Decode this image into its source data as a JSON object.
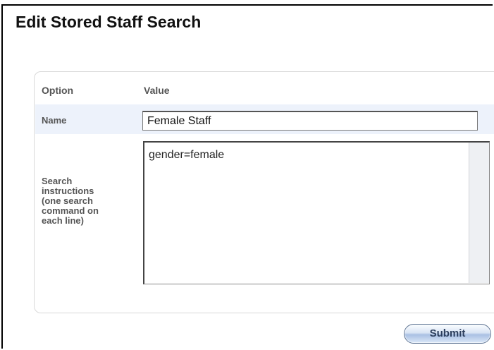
{
  "page": {
    "title": "Edit Stored Staff Search"
  },
  "table": {
    "headers": {
      "option": "Option",
      "value": "Value"
    },
    "rows": [
      {
        "label": "Name",
        "value": "Female Staff"
      },
      {
        "label_lines": [
          "Search",
          "instructions",
          "(one search",
          "command on",
          "each line)"
        ],
        "value": "gender=female"
      }
    ]
  },
  "actions": {
    "submit_label": "Submit"
  },
  "colors": {
    "name_row_background": "#edf2fb",
    "submit_button_accent": "#a9c0e3"
  }
}
